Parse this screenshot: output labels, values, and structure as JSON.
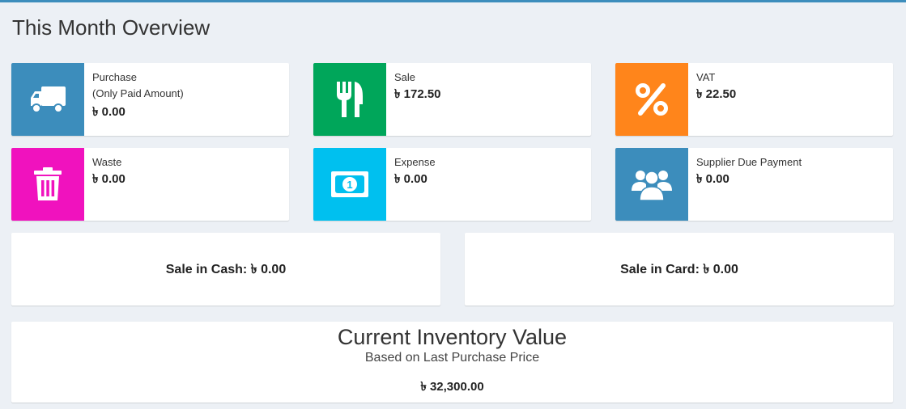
{
  "page": {
    "title": "This Month Overview"
  },
  "colors": {
    "purchase": "#3c8dbc",
    "sale": "#00a65a",
    "vat": "#ff851b",
    "waste": "#f012be",
    "expense": "#00c0ef",
    "supplier": "#3c8dbc"
  },
  "cards": {
    "purchase": {
      "icon": "truck-icon",
      "label": "Purchase",
      "sublabel": "(Only Paid Amount)",
      "value": "৳ 0.00"
    },
    "sale": {
      "icon": "fork-knife-icon",
      "label": "Sale",
      "value": "৳ 172.50"
    },
    "vat": {
      "icon": "percent-icon",
      "label": "VAT",
      "value": "৳ 22.50"
    },
    "waste": {
      "icon": "trash-icon",
      "label": "Waste",
      "value": "৳ 0.00"
    },
    "expense": {
      "icon": "money-bill-icon",
      "label": "Expense",
      "value": "৳ 0.00"
    },
    "supplier": {
      "icon": "users-icon",
      "label": "Supplier Due Payment",
      "value": "৳ 0.00"
    }
  },
  "sale_cash": "Sale in Cash: ৳ 0.00",
  "sale_card": "Sale in Card: ৳ 0.00",
  "inventory": {
    "title": "Current Inventory Value",
    "subtitle": "Based on Last Purchase Price",
    "value": "৳ 32,300.00"
  }
}
